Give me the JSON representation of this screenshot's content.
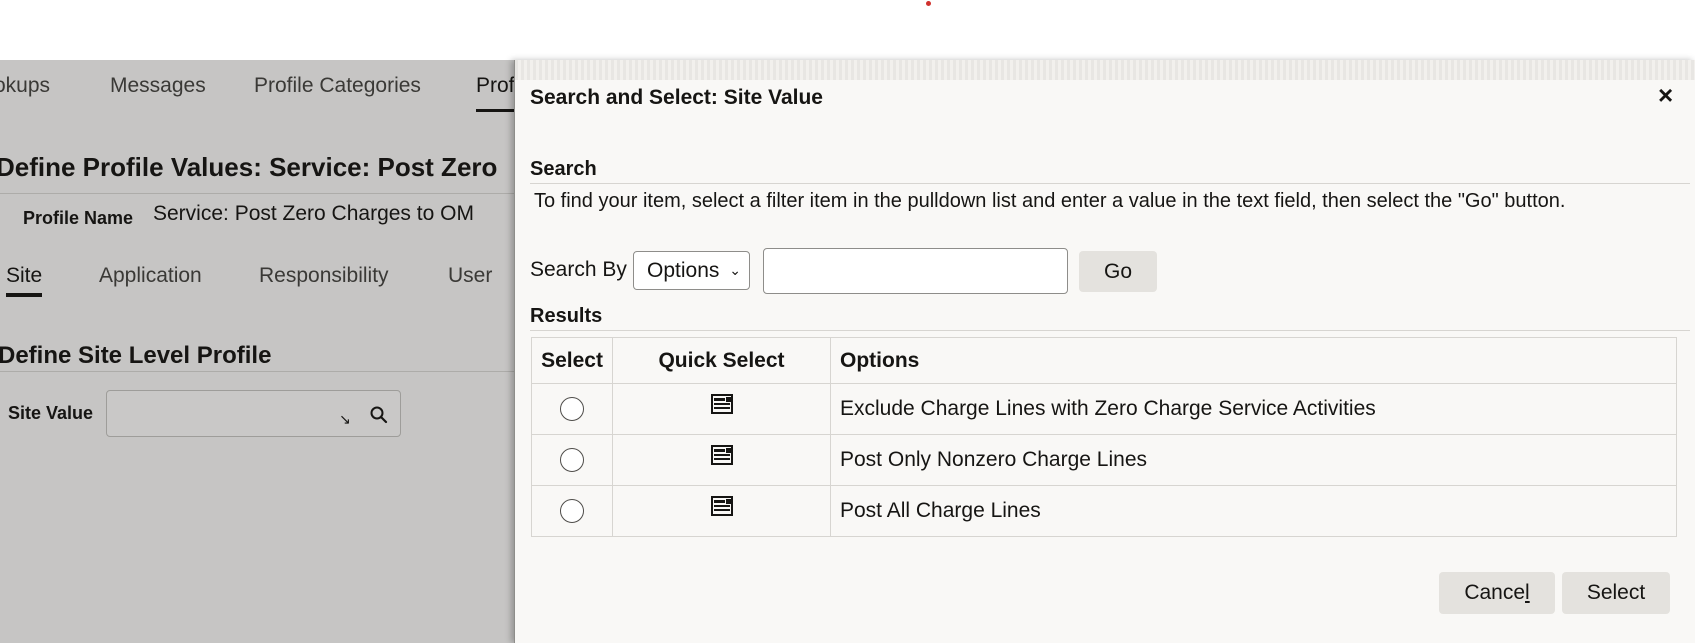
{
  "background": {
    "tabs": [
      "okups",
      "Messages",
      "Profile Categories",
      "Prof"
    ],
    "page_title": "Define Profile Values: Service: Post Zero",
    "profile_name_label": "Profile Name",
    "profile_name_value": "Service: Post Zero Charges to OM",
    "level_tabs": [
      "Site",
      "Application",
      "Responsibility",
      "User"
    ],
    "section_title": "Define Site Level Profile",
    "site_value_label": "Site Value",
    "site_value_input": ""
  },
  "dialog": {
    "title": "Search and Select: Site Value",
    "close_icon": "close-icon",
    "search_section_title": "Search",
    "instructions": "To find your item, select a filter item in the pulldown list and enter a value in the text field, then select the \"Go\" button.",
    "search_by_label": "Search By",
    "search_by_selected": "Options",
    "search_input_value": "",
    "go_label": "Go",
    "results_section_title": "Results",
    "columns": [
      "Select",
      "Quick Select",
      "Options"
    ],
    "rows": [
      {
        "option": "Exclude Charge Lines with Zero Charge Service Activities"
      },
      {
        "option": "Post Only Nonzero Charge Lines"
      },
      {
        "option": "Post All Charge Lines"
      }
    ],
    "cancel_label_pre": "Cance",
    "cancel_label_underlined": "l",
    "select_label": "Select"
  },
  "colors": {
    "dialog_bg": "#f9f8f6",
    "dimmed_bg": "#c6c5c4",
    "button_bg": "#e4e2de",
    "indicator_dot": "#d0312d"
  }
}
